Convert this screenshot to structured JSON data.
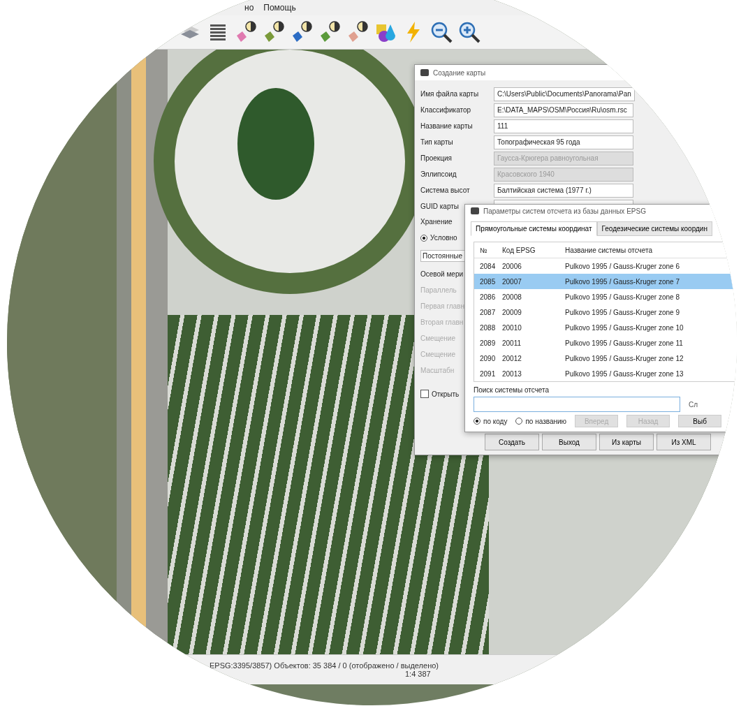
{
  "menu": [
    {
      "label": "но"
    },
    {
      "label": "Помощь"
    }
  ],
  "toolbar": [
    {
      "kind": "layers"
    },
    {
      "kind": "list"
    },
    {
      "kind": "add"
    },
    {
      "kind": "edit"
    },
    {
      "kind": "plus"
    },
    {
      "kind": "heart"
    },
    {
      "kind": "delete"
    },
    {
      "kind": "palette"
    },
    {
      "kind": "bolt"
    },
    {
      "kind": "zoom-out"
    },
    {
      "kind": "zoom-in"
    }
  ],
  "create_dialog": {
    "title": "Создание карты",
    "fields": [
      {
        "label": "Имя файла карты",
        "value": "C:\\Users\\Public\\Documents\\Panorama\\Pan",
        "disabled": false
      },
      {
        "label": "Классификатор",
        "value": "E:\\DATA_MAPS\\OSM\\Россия\\Ru\\osm.rsc",
        "disabled": false
      },
      {
        "label": "Название карты",
        "value": "111",
        "disabled": false
      },
      {
        "label": "Тип карты",
        "value": "Топографическая 95 года",
        "disabled": false
      },
      {
        "label": "Проекция",
        "value": "Гаусса-Крюгера равноугольная",
        "disabled": true
      },
      {
        "label": "Эллипсоид",
        "value": "Красовского 1940",
        "disabled": true
      },
      {
        "label": "Система высот",
        "value": "Балтийская система (1977 г.)",
        "disabled": false
      },
      {
        "label": "GUID карты"
      }
    ],
    "storage_label": "Хранение",
    "storage_option": {
      "label": "Условно",
      "selected": true
    },
    "tab": "Постоянные",
    "params": [
      {
        "label": "Осевой мери",
        "disabled": false
      },
      {
        "label": "Параллель",
        "disabled": true
      },
      {
        "label": "Первая главн",
        "disabled": true
      },
      {
        "label": "Вторая главн",
        "disabled": true
      },
      {
        "label": "Смещение",
        "disabled": true
      },
      {
        "label": "Смещение",
        "disabled": true
      },
      {
        "label": "Масштабн",
        "disabled": true
      }
    ],
    "open_checkbox": {
      "label": "Открыть",
      "checked": false
    },
    "buttons": [
      "Создать",
      "Выход",
      "Из карты",
      "Из XML"
    ]
  },
  "epsg_dialog": {
    "title": "Параметры систем отсчета из базы данных EPSG",
    "tabs": [
      {
        "label": "Прямоугольные системы координат",
        "selected": true
      },
      {
        "label": "Геодезические системы координ",
        "selected": false
      }
    ],
    "columns": [
      "№",
      "Код EPSG",
      "Название системы отсчета"
    ],
    "rows": [
      {
        "cells": [
          "2084",
          "20006",
          "Pulkovo 1995 / Gauss-Kruger zone 6"
        ],
        "selected": false
      },
      {
        "cells": [
          "2085",
          "20007",
          "Pulkovo 1995 / Gauss-Kruger zone 7"
        ],
        "selected": true
      },
      {
        "cells": [
          "2086",
          "20008",
          "Pulkovo 1995 / Gauss-Kruger zone 8"
        ],
        "selected": false
      },
      {
        "cells": [
          "2087",
          "20009",
          "Pulkovo 1995 / Gauss-Kruger zone 9"
        ],
        "selected": false
      },
      {
        "cells": [
          "2088",
          "20010",
          "Pulkovo 1995 / Gauss-Kruger zone 10"
        ],
        "selected": false
      },
      {
        "cells": [
          "2089",
          "20011",
          "Pulkovo 1995 / Gauss-Kruger zone 11"
        ],
        "selected": false
      },
      {
        "cells": [
          "2090",
          "20012",
          "Pulkovo 1995 / Gauss-Kruger zone 12"
        ],
        "selected": false
      },
      {
        "cells": [
          "2091",
          "20013",
          "Pulkovo 1995 / Gauss-Kruger zone 13"
        ],
        "selected": false
      }
    ],
    "search_label": "Поиск системы отсчета",
    "radios": [
      {
        "label": "по коду",
        "selected": true
      },
      {
        "label": "по названию",
        "selected": false
      }
    ],
    "buttons": [
      {
        "label": "Вперед",
        "disabled": true
      },
      {
        "label": "Назад",
        "disabled": true
      },
      {
        "label": "Выб",
        "disabled": false
      }
    ],
    "side_text": "Сл"
  },
  "status": {
    "coords": "EPSG:3395/3857)  Объектов: 35 384 / 0 (отображено / выделено)",
    "scale": "1:4 387"
  }
}
